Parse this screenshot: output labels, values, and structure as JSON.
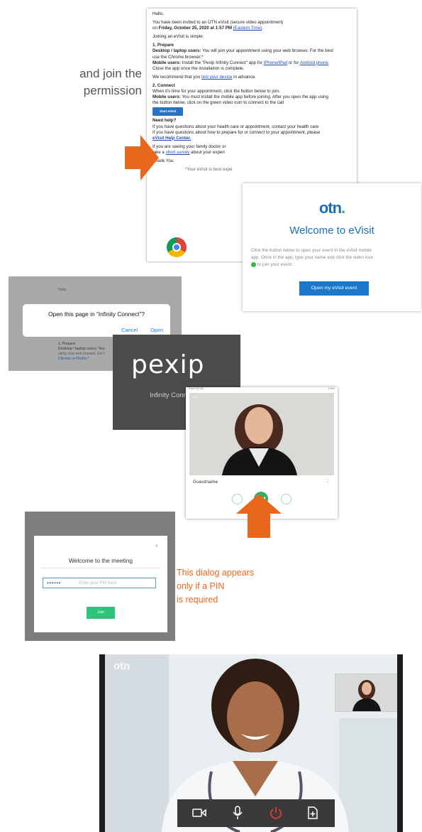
{
  "intro": {
    "line1": "and join the",
    "line2": "permission"
  },
  "email": {
    "greeting": "Hello,",
    "invite_pre": "You have been invited to an OTN eVisit (secure video appointment)",
    "invite_on": "on ",
    "invite_date": "Friday, October 25, 2020 at 1:57 PM",
    "invite_tz": "(Eastern Time)",
    "invite_end": ".",
    "joining": "Joining an eVisit is simple:",
    "prepare_heading": "1. Prepare",
    "desktop_label": "Desktop / laptop users:",
    "desktop_text": " You will join your appointment using your web browser. For the best",
    "desktop_text2": "use the Chrome browser.*",
    "mobile_label": "Mobile users:",
    "mobile_text": " Install the \"Pexip Infinity Connect\" app for ",
    "mobile_iphone": "iPhone/iPad",
    "mobile_or": " or for ",
    "mobile_android": "Android phone",
    "mobile_text2": "Close the app once the installation is complete.",
    "recommend_pre": "We recommend that you ",
    "recommend_link": "test your device",
    "recommend_post": " in advance.",
    "connect_heading": "2. Connect",
    "connect_text": "When it's time for your appointment, click the button below to join.",
    "mobile2_label": "Mobile users:",
    "mobile2_text": " You must install the mobile app before joining. After you open the app using",
    "mobile2_text2": "the button below, click on the green video icon to connect to the call",
    "start_button": "Start eVisit",
    "help_heading": "Need help?",
    "help_text1": "If you have questions about your health care or appointment, contact your health care",
    "help_text2": "If you have questions about how to prepare for or connect to your appointment, please",
    "help_link": "eVisit Help Center.",
    "family_text1": "If you are seeing your family doctor or",
    "family_text2_pre": "take a ",
    "family_link": "short survey",
    "family_text2_post": " about your experi",
    "thanks": "Thank You.",
    "footnote": "*Your eVisit is best expe"
  },
  "welcome": {
    "logo": "otn",
    "logo_dot": ".",
    "title": "Welcome to eVisit",
    "text1": "Click the button below to open your event in the eVisit mobile",
    "text2": "app. Once in the app, type your name and click the video icon",
    "text3": "to join your event.",
    "button": "Open my eVisit event"
  },
  "ios_dialog": {
    "bg_heading": "Hello,",
    "bg_line1": "1. Prepare",
    "bg_line2": "Desktop / laptop users: You",
    "bg_line3": "using your web browser. For t",
    "bg_line4": "Chrome or Firefox.*",
    "title": "Open this page in “Infinity Connect”?",
    "cancel": "Cancel",
    "open": "Open"
  },
  "pexip": {
    "logo": "pexip",
    "subtitle": "Infinity Connect"
  },
  "call": {
    "status_left": "iPad 9:52 AM",
    "status_right": "100%",
    "app_label": "pexip",
    "guest_name": "Guestname",
    "more": "⋮",
    "ctl_left": "camera",
    "ctl_right": "mic"
  },
  "pin_dialog": {
    "title": "Welcome to the meeting",
    "close": "×",
    "pin_mask": "••••••",
    "placeholder": "Enter your PIN here",
    "join": "Join"
  },
  "note": {
    "line1": "This dialog appears",
    "line2": "only if a PIN",
    "line3": "is required"
  },
  "photo": {
    "logo": "otn"
  },
  "colors": {
    "accent_orange": "#e8671c",
    "otn_blue": "#1b6fb8",
    "join_green": "#2ec47b",
    "ios_blue": "#1a7cf5"
  }
}
